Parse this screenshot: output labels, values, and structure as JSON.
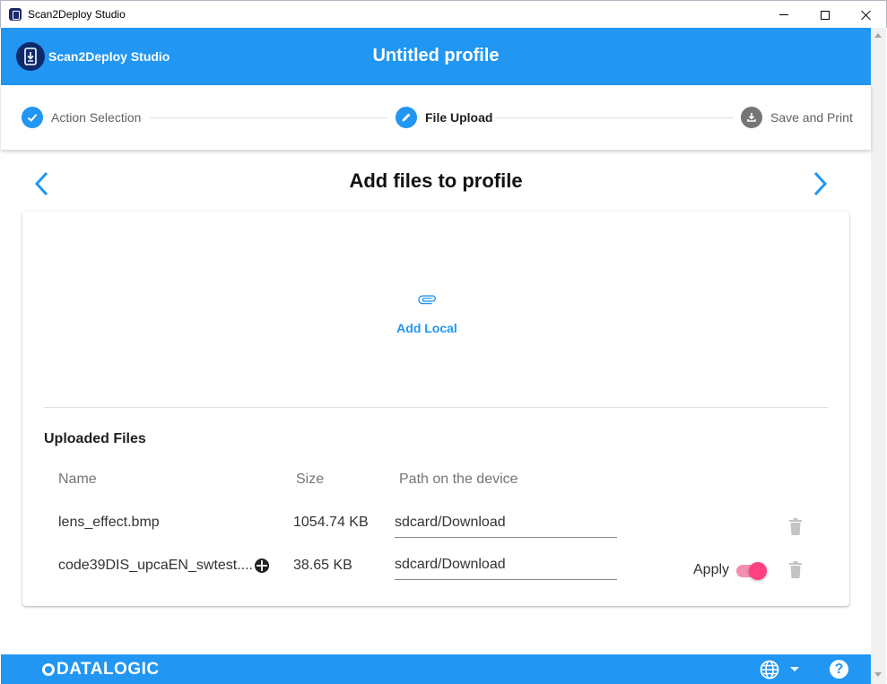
{
  "window": {
    "title": "Scan2Deploy Studio",
    "controls": [
      "minimize",
      "maximize",
      "close"
    ]
  },
  "header": {
    "brand": "Scan2Deploy Studio",
    "profile_title": "Untitled profile",
    "brand_icon": "device-download-icon"
  },
  "stepper": {
    "steps": [
      {
        "label": "Action Selection",
        "state": "completed",
        "icon": "check-icon"
      },
      {
        "label": "File Upload",
        "state": "active",
        "icon": "pencil-icon"
      },
      {
        "label": "Save and Print",
        "state": "pending",
        "icon": "download-tray-icon"
      }
    ]
  },
  "main": {
    "heading": "Add files to profile",
    "add_local_label": "Add Local",
    "uploaded_title": "Uploaded Files",
    "columns": {
      "name": "Name",
      "size": "Size",
      "path": "Path on the device"
    },
    "files": [
      {
        "name": "lens_effect.bmp",
        "size": "1054.74 KB",
        "path": "sdcard/Download",
        "has_apply": false
      },
      {
        "name": "code39DIS_upcaEN_swtest....",
        "size": "38.65 KB",
        "path": "sdcard/Download",
        "has_apply": true,
        "apply_label": "Apply",
        "apply_on": true
      }
    ]
  },
  "footer": {
    "logo": "DATALOGIC",
    "help_label": "?"
  },
  "colors": {
    "primary": "#2196f3",
    "brand_dark": "#0d2a6b",
    "accent": "#ff4081",
    "step_pending": "#757575"
  }
}
